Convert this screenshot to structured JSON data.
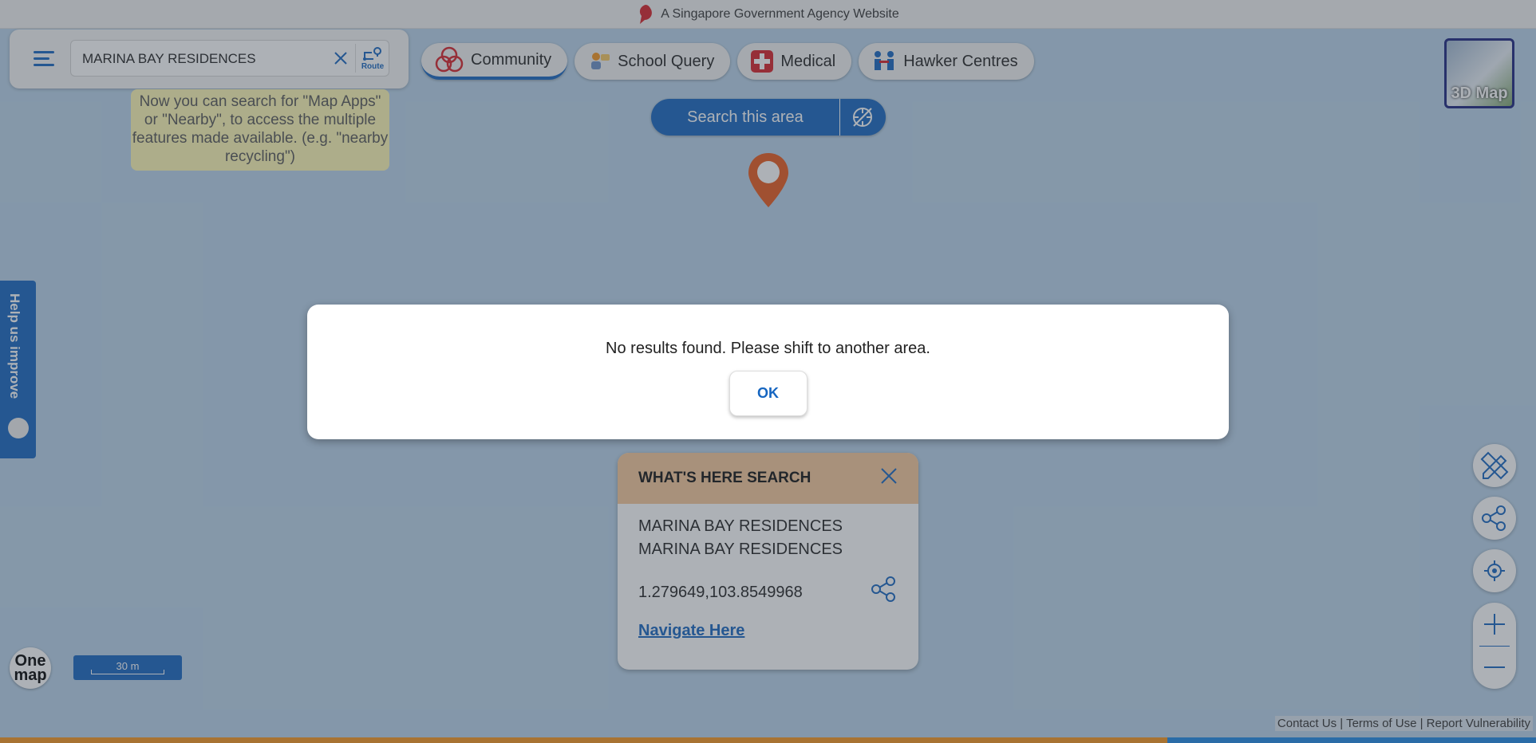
{
  "gov_banner": {
    "text": "A Singapore Government Agency Website"
  },
  "search": {
    "value": "MARINA BAY RESIDENCES",
    "route_label": "Route"
  },
  "tip": {
    "text": "Now you can search for \"Map Apps\" or \"Nearby\", to access the multiple features made available. (e.g. \"nearby recycling\")"
  },
  "chips": [
    {
      "label": "Community",
      "icon": "community-icon",
      "active": true
    },
    {
      "label": "School Query",
      "icon": "school-icon"
    },
    {
      "label": "Medical",
      "icon": "medical-cross-icon"
    },
    {
      "label": "Hawker Centres",
      "icon": "hawker-icon"
    }
  ],
  "search_area": {
    "label": "Search this area"
  },
  "map3d": {
    "label": "3D Map"
  },
  "help": {
    "label": "Help us improve"
  },
  "whats_here": {
    "title": "WHAT'S HERE SEARCH",
    "name": "MARINA BAY RESIDENCES",
    "address": "MARINA BAY RESIDENCES",
    "coords": "1.279649,103.8549968",
    "navigate": "Navigate Here"
  },
  "logo": {
    "text": "One map"
  },
  "scale": {
    "label": "30 m"
  },
  "footer": {
    "contact": "Contact Us",
    "terms": "Terms of Use",
    "report": "Report Vulnerability",
    "separator": " | "
  },
  "dialog": {
    "message": "No results found. Please shift to another area.",
    "ok": "OK"
  },
  "colors": {
    "brand_blue": "#1565c0",
    "pin_orange": "#e8591a",
    "bottom_orange": "#f7941d",
    "bottom_blue": "#1e88e5",
    "tip_yellow": "#fff8b3",
    "panel_header": "#f6c99a"
  }
}
